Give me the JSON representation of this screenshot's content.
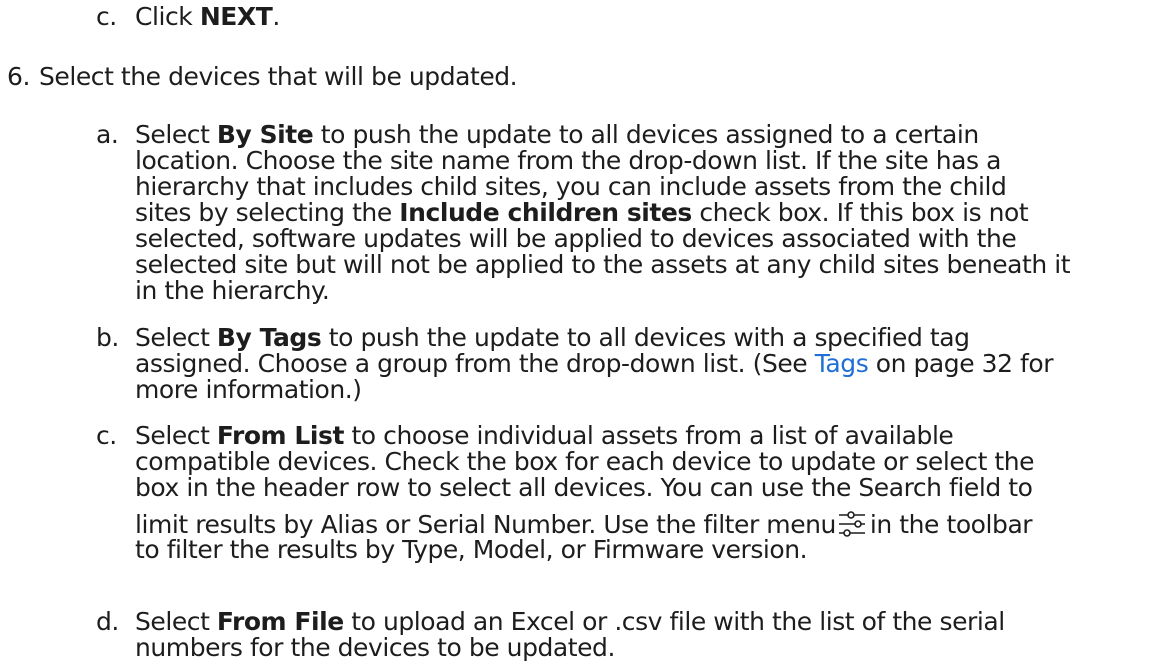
{
  "step_5": {
    "item_c": {
      "marker": "c.",
      "prefix": "Click ",
      "bold": "NEXT",
      "suffix": "."
    }
  },
  "step_6": {
    "number": "6.",
    "text": "Select the devices that will be updated.",
    "item_a": {
      "marker": "a.",
      "l1_pre": "Select ",
      "l1_bold": "By Site",
      "l1_post": " to push the update to all devices assigned to a certain",
      "l2": "location. Choose the site name from the drop-down list. If the site has a",
      "l3": "hierarchy that includes child sites, you can include assets from the child",
      "l4_pre": "sites by selecting the ",
      "l4_bold": "Include children sites",
      "l4_post": " check box. If this box is not",
      "l5": "selected, software updates will be applied to devices associated with the",
      "l6": "selected site but will not be applied to the assets at any child sites beneath it",
      "l7": "in the hierarchy."
    },
    "item_b": {
      "marker": "b.",
      "l1_pre": "Select ",
      "l1_bold": "By Tags",
      "l1_post": " to push the update to all devices with a specified tag",
      "l2_pre": "assigned. Choose a group from the drop-down list. (See ",
      "l2_link": "Tags",
      "l2_post": " on page 32 for",
      "l3": "more information.)"
    },
    "item_c": {
      "marker": "c.",
      "l1_pre": "Select ",
      "l1_bold": "From List",
      "l1_post": " to choose individual assets from a list of available",
      "l2": "compatible devices. Check the box for each device to update or select the",
      "l3": "box in the header row to select all devices. You can use the Search field to",
      "l4_pre": "limit results by Alias or Serial Number. Use the filter menu",
      "l4_post": "in the toolbar",
      "l5": "to filter the results by Type, Model, or Firmware version.",
      "icon": "filter-icon"
    },
    "item_d": {
      "marker": "d.",
      "l1_pre": "Select ",
      "l1_bold": "From File",
      "l1_post": " to upload an Excel or .csv file with the list of the serial",
      "l2": "numbers for the devices to be updated."
    }
  },
  "colors": {
    "text": "#1d1d1d",
    "link": "#1f6fd6"
  }
}
